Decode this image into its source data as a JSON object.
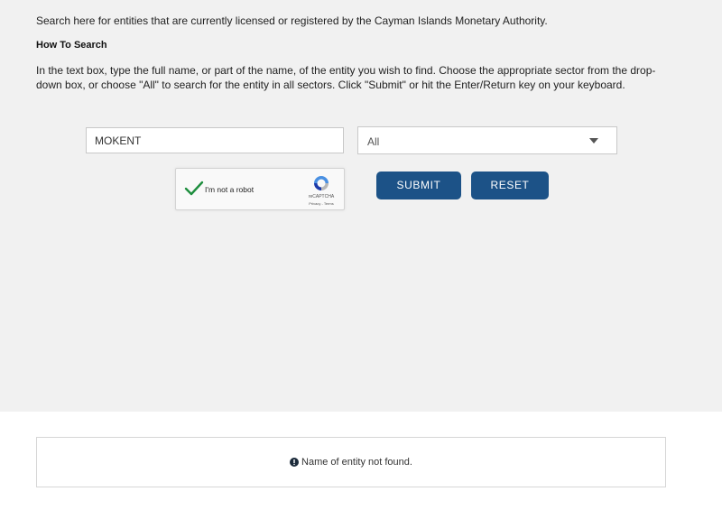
{
  "intro_text": "Search here for entities that are currently licensed or registered by the Cayman Islands Monetary Authority.",
  "how_to_search": {
    "heading": "How To Search",
    "instructions_line1": "In the text box, type the full name, or part of the name, of the entity you wish to find. Choose the appropriate sector from the drop-",
    "instructions_line2": "down box, or choose \"All\" to search for the entity in all sectors. Click \"Submit\" or hit the Enter/Return key on your keyboard."
  },
  "search_form": {
    "entity_name_value": "MOKENT",
    "sector_selected": "All",
    "captcha": {
      "label": "I'm not a robot",
      "brand": "reCAPTCHA",
      "links": "Privacy - Terms",
      "checked_color": "#1e8e3e"
    },
    "submit_label": "SUBMIT",
    "reset_label": "RESET"
  },
  "result": {
    "icon": "info-circle-icon",
    "message": "Name of entity not found."
  },
  "colors": {
    "panel_background": "#f1f1f1",
    "button_primary": "#1c5287",
    "icon_dark": "#1b2a3a"
  }
}
